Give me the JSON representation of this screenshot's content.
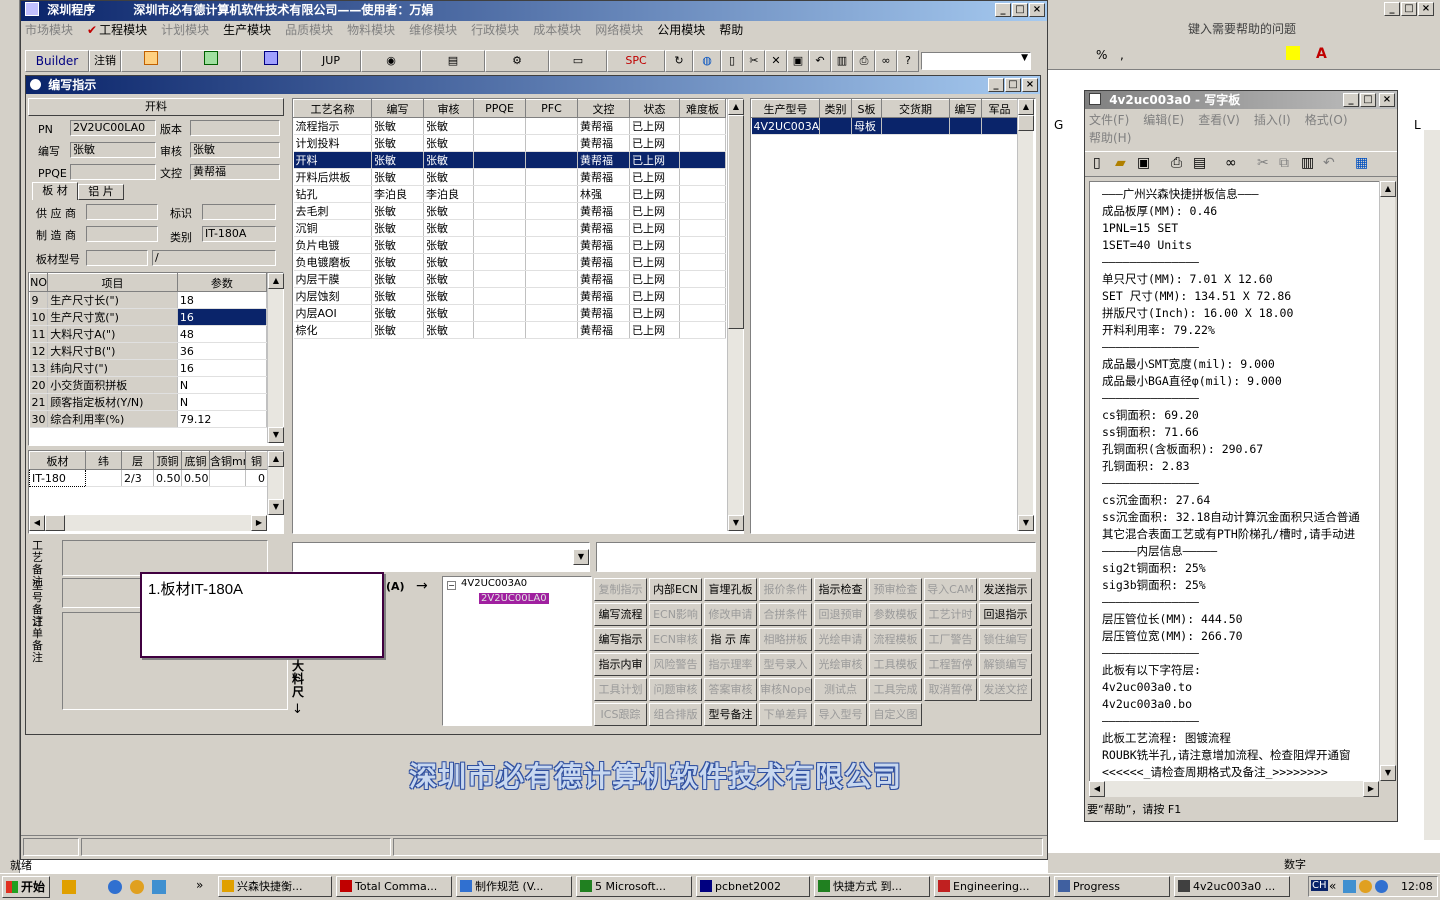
{
  "app": {
    "title": "深圳程序",
    "subtitle": "深圳市必有德计算机软件技术有限公司——使用者：万娟",
    "menu": [
      "市场模块",
      "工程模块",
      "计划模块",
      "生产模块",
      "品质模块",
      "物料模块",
      "维修模块",
      "行政模块",
      "成本模块",
      "网络模块",
      "公用模块",
      "帮助"
    ],
    "builder": "Builder",
    "logout": "注销",
    "toolbar_jup": "JUP",
    "toolbar_spc": "SPC",
    "company_banner": "深圳市必有德计算机软件技术有限公司",
    "status_ready": "就绪"
  },
  "excel_bg": {
    "help_box": "键入需要帮助的问题",
    "col_g": "G",
    "col_l": "L",
    "status_num": "数字"
  },
  "form": {
    "title": "编写指示",
    "process_header": "开料",
    "pn_label": "PN",
    "pn_value": "2V2UC00LA0",
    "version_label": "版本",
    "version_value": "",
    "writer_label": "编写",
    "writer_value": "张敏",
    "reviewer_label": "审核",
    "reviewer_value": "张敏",
    "ppqe_label": "PPQE",
    "ppqe_value": "",
    "doc_label": "文控",
    "doc_value": "黄帮福",
    "tab_board": "板 材",
    "tab_copper": "铝 片",
    "supplier_label": "供 应 商",
    "mark_label": "标识",
    "maker_label": "制 造 商",
    "type_label": "类别",
    "type_value": "IT-180A",
    "model_label": "板材型号",
    "model_value2": "/",
    "params_headers": [
      "NO",
      "项目",
      "参数"
    ],
    "params": [
      {
        "no": "9",
        "item": "生产尺寸长(\")",
        "val": "18"
      },
      {
        "no": "10",
        "item": "生产尺寸宽(\")",
        "val": "16"
      },
      {
        "no": "11",
        "item": "大料尺寸A(\")",
        "val": "48"
      },
      {
        "no": "12",
        "item": "大料尺寸B(\")",
        "val": "36"
      },
      {
        "no": "13",
        "item": "纬向尺寸(\")",
        "val": "16"
      },
      {
        "no": "20",
        "item": "小交货面积拼板",
        "val": "N"
      },
      {
        "no": "21",
        "item": "顾客指定板材(Y/N)",
        "val": "N"
      },
      {
        "no": "30",
        "item": "综合利用率(%)",
        "val": "79.12"
      }
    ],
    "mat_headers": [
      "板材",
      "纬",
      "层",
      "顶铜",
      "底铜",
      "含铜mm",
      "铜"
    ],
    "mat_row": [
      "IT-180",
      "",
      "2/3",
      "0.50",
      "0.50",
      "",
      "0"
    ],
    "remark_process": "工艺备注",
    "remark_model": "型号备注",
    "remark_order": "订单备注",
    "note_popup": "1.板材IT-180A",
    "diagram_label_a": "(A)",
    "diagram_vertical": "大料尺",
    "tree_root": "4V2UC003A0",
    "tree_child": "2V2UC00LA0"
  },
  "process_grid": {
    "headers": [
      "工艺名称",
      "编写",
      "审核",
      "PPQE",
      "PFC",
      "文控",
      "状态",
      "难度板"
    ],
    "rows": [
      [
        "流程指示",
        "张敏",
        "张敏",
        "",
        "",
        "黄帮福",
        "已上网",
        ""
      ],
      [
        "计划投料",
        "张敏",
        "张敏",
        "",
        "",
        "黄帮福",
        "已上网",
        ""
      ],
      [
        "开料",
        "张敏",
        "张敏",
        "",
        "",
        "黄帮福",
        "已上网",
        ""
      ],
      [
        "开料后烘板",
        "张敏",
        "张敏",
        "",
        "",
        "黄帮福",
        "已上网",
        ""
      ],
      [
        "钻孔",
        "李泊良",
        "李泊良",
        "",
        "",
        "林强",
        "已上网",
        ""
      ],
      [
        "去毛刺",
        "张敏",
        "张敏",
        "",
        "",
        "黄帮福",
        "已上网",
        ""
      ],
      [
        "沉铜",
        "张敏",
        "张敏",
        "",
        "",
        "黄帮福",
        "已上网",
        ""
      ],
      [
        "负片电镀",
        "张敏",
        "张敏",
        "",
        "",
        "黄帮福",
        "已上网",
        ""
      ],
      [
        "负电镀磨板",
        "张敏",
        "张敏",
        "",
        "",
        "黄帮福",
        "已上网",
        ""
      ],
      [
        "内层干膜",
        "张敏",
        "张敏",
        "",
        "",
        "黄帮福",
        "已上网",
        ""
      ],
      [
        "内层蚀刻",
        "张敏",
        "张敏",
        "",
        "",
        "黄帮福",
        "已上网",
        ""
      ],
      [
        "内层AOI",
        "张敏",
        "张敏",
        "",
        "",
        "黄帮福",
        "已上网",
        ""
      ],
      [
        "棕化",
        "张敏",
        "张敏",
        "",
        "",
        "黄帮福",
        "已上网",
        ""
      ]
    ],
    "selected_index": 2
  },
  "model_grid": {
    "headers": [
      "生产型号",
      "类别",
      "S板",
      "交货期",
      "编写",
      "军品"
    ],
    "row": [
      "4V2UC003A0",
      "",
      "母板",
      "",
      "",
      ""
    ]
  },
  "buttons": [
    {
      "label": "复制指示",
      "enabled": false
    },
    {
      "label": "内部ECN",
      "enabled": true
    },
    {
      "label": "盲埋孔板",
      "enabled": true
    },
    {
      "label": "报价条件",
      "enabled": false
    },
    {
      "label": "指示检查",
      "enabled": true
    },
    {
      "label": "预审检查",
      "enabled": false
    },
    {
      "label": "导入CAM",
      "enabled": false
    },
    {
      "label": "发送指示",
      "enabled": true
    },
    {
      "label": "编写流程",
      "enabled": true
    },
    {
      "label": "ECN影响",
      "enabled": false
    },
    {
      "label": "修改申请",
      "enabled": false
    },
    {
      "label": "合拼条件",
      "enabled": false
    },
    {
      "label": "回退预审",
      "enabled": false
    },
    {
      "label": "参数模板",
      "enabled": false
    },
    {
      "label": "工艺计时",
      "enabled": false
    },
    {
      "label": "回退指示",
      "enabled": true
    },
    {
      "label": "编写指示",
      "enabled": true
    },
    {
      "label": "ECN审核",
      "enabled": false
    },
    {
      "label": "指 示 库",
      "enabled": true
    },
    {
      "label": "相略拼板",
      "enabled": false
    },
    {
      "label": "光绘申请",
      "enabled": false
    },
    {
      "label": "流程模板",
      "enabled": false
    },
    {
      "label": "工厂警告",
      "enabled": false
    },
    {
      "label": "锁住编写",
      "enabled": false
    },
    {
      "label": "指示内审",
      "enabled": true
    },
    {
      "label": "风险警告",
      "enabled": false
    },
    {
      "label": "指示理率",
      "enabled": false
    },
    {
      "label": "型号录入",
      "enabled": false
    },
    {
      "label": "光绘审核",
      "enabled": false
    },
    {
      "label": "工具模板",
      "enabled": false
    },
    {
      "label": "工程暂停",
      "enabled": false
    },
    {
      "label": "解锁编写",
      "enabled": false
    },
    {
      "label": "工具计划",
      "enabled": false
    },
    {
      "label": "问题审核",
      "enabled": false
    },
    {
      "label": "答案审核",
      "enabled": false
    },
    {
      "label": "审核Nope",
      "enabled": false
    },
    {
      "label": "测试点",
      "enabled": false
    },
    {
      "label": "工具完成",
      "enabled": false
    },
    {
      "label": "取消暂停",
      "enabled": false
    },
    {
      "label": "发送文控",
      "enabled": false
    },
    {
      "label": "ICS跟踪",
      "enabled": false
    },
    {
      "label": "组合排版",
      "enabled": false
    },
    {
      "label": "型号备注",
      "enabled": true
    },
    {
      "label": "下单差异",
      "enabled": false
    },
    {
      "label": "导入型号",
      "enabled": false
    },
    {
      "label": "自定义图",
      "enabled": false
    }
  ],
  "notepad": {
    "title": "4v2uc003a0 - 写字板",
    "menu": [
      "文件(F)",
      "编辑(E)",
      "查看(V)",
      "插入(I)",
      "格式(O)",
      "帮助(H)"
    ],
    "lines": [
      "———广州兴森快捷拼板信息———",
      "成品板厚(MM): 0.46",
      "1PNL=15 SET",
      "1SET=40 Units",
      "——————————————",
      "单只尺寸(MM): 7.01 X 12.60",
      "SET 尺寸(MM): 134.51 X 72.86",
      "拼版尺寸(Inch): 16.00 X 18.00",
      "开料利用率: 79.22%",
      "——————————————",
      "成品最小SMT宽度(mil): 9.000",
      "成品最小BGA直径φ(mil): 9.000",
      "——————————————",
      "cs铜面积: 69.20",
      "ss铜面积: 71.66",
      "孔铜面积(含板面积): 290.67",
      "孔铜面积: 2.83",
      "——————————————",
      "cs沉金面积: 27.64",
      "ss沉金面积: 32.18自动计算沉金面积只适合普通",
      "其它混合表面工艺或有PTH阶梯孔/槽时,请手动进",
      "—————内层信息—————",
      "sig2t铜面积: 25%",
      "sig3b铜面积: 25%",
      "——————————————",
      "层压管位长(MM): 444.50",
      "层压管位宽(MM): 266.70",
      "——————————————",
      "此板有以下字符层:",
      "4v2uc003a0.to",
      "4v2uc003a0.bo",
      "——————————————",
      "此板工艺流程: 图镀流程",
      "ROUBK铣半孔,请注意增加流程、检查阻焊开通窗",
      "<<<<<<_请检查周期格式及备注_>>>>>>>>"
    ],
    "status": "要“帮助”，请按 F1"
  },
  "taskbar": {
    "start": "开始",
    "items": [
      "兴森快捷衡...",
      "Total Comma...",
      "制作规范 (V...",
      "5 Microsoft...",
      "pcbnet2002",
      "快捷方式 到...",
      "Engineering...",
      "Progress",
      "4v2uc003a0 ..."
    ],
    "tray_label": "CH",
    "clock": "12:08"
  }
}
